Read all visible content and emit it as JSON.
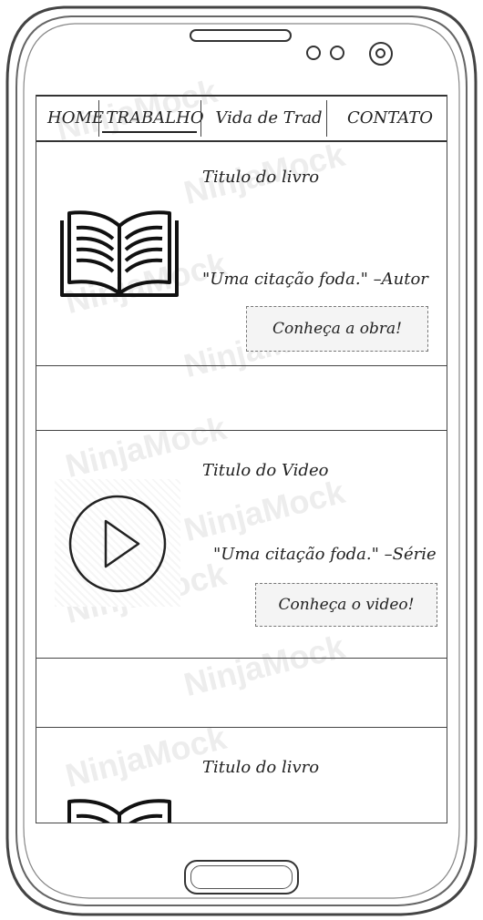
{
  "nav": {
    "items": [
      {
        "label": "HOME"
      },
      {
        "label": "TRABALHO"
      },
      {
        "label": "Vida de Trad"
      },
      {
        "label": "CONTATO"
      }
    ],
    "active_index": 1
  },
  "cards": [
    {
      "title": "Titulo do livro",
      "quote": "\"Uma citação foda.\" –Autor",
      "button": "Conheça a obra!",
      "icon": "open-book-icon"
    },
    {
      "title": "Titulo do Video",
      "quote": "\"Uma citação foda.\" –Série",
      "button": "Conheça o video!",
      "icon": "play-icon"
    },
    {
      "title": "Titulo do livro",
      "icon": "open-book-icon"
    }
  ],
  "watermark": "NinjaMock",
  "colors": {
    "ink": "#222222",
    "frame": "#555555",
    "button_fill": "#f4f4f4"
  }
}
